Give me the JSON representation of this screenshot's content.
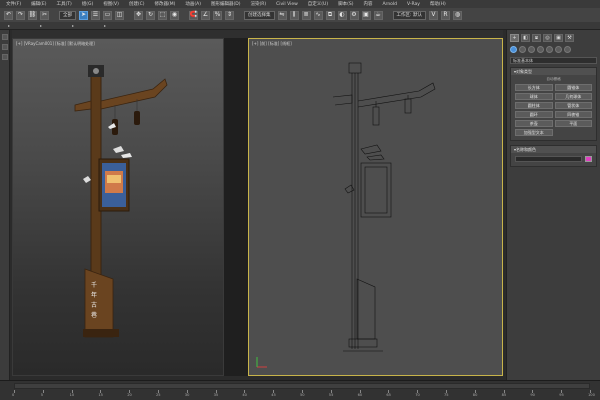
{
  "menu": [
    "文件(F)",
    "编辑(E)",
    "工具(T)",
    "组(G)",
    "视图(V)",
    "创建(C)",
    "修改器(M)",
    "动画(A)",
    "图形编辑器(D)",
    "渲染(R)",
    "Civil View",
    "自定义(U)",
    "脚本(S)",
    "内容",
    "Arnold",
    "V-Ray",
    "帮助(H)"
  ],
  "toolbar": {
    "select_filter": "全部",
    "named_set": "创建选择集",
    "workspace": "工作区: 默认"
  },
  "viewports": {
    "left_label": "[+] [VRayCam001] [标准] [默认明暗处理]",
    "right_label": "[+] [前] [标准] [线框]"
  },
  "signpost_text": "千年古巷",
  "command_panel": {
    "dropdown": "标准基本体",
    "rollout_title": "对象类型",
    "autogrid": "自动栅格",
    "buttons": [
      "长方体",
      "圆锥体",
      "球体",
      "几何球体",
      "圆柱体",
      "管状体",
      "圆环",
      "四棱锥",
      "茶壶",
      "平面",
      "加强型文本"
    ],
    "name_rollout": "名称和颜色",
    "color_hex": "#e040c0"
  },
  "timeline": {
    "ticks": [
      "0",
      "5",
      "10",
      "15",
      "20",
      "25",
      "30",
      "35",
      "40",
      "45",
      "50",
      "55",
      "60",
      "65",
      "70",
      "75",
      "80",
      "85",
      "90",
      "95",
      "100"
    ]
  }
}
